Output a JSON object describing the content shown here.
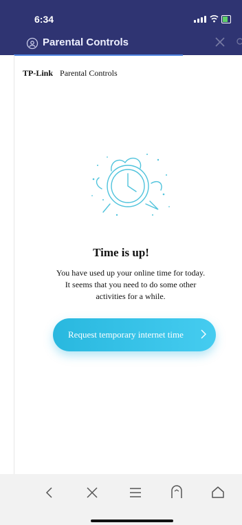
{
  "status": {
    "time": "6:34"
  },
  "header": {
    "title": "Parental Controls"
  },
  "site": {
    "brand": "TP-Link",
    "section": "Parental Controls"
  },
  "notice": {
    "heading": "Time is up!",
    "lines": [
      "You have used up your online time for today.",
      "It seems that you need to do some other",
      "activities for a while."
    ]
  },
  "actions": {
    "request_label": "Request temporary internet time"
  },
  "colors": {
    "header_bg": "#2f3472",
    "button_start": "#29b8df",
    "button_end": "#45ccf0",
    "illustration": "#4fc3dc",
    "toolbar_bg": "#f2f2f2"
  },
  "icons": {
    "app": "parental-controls-icon",
    "close": "close-icon",
    "toolbar": [
      "back-icon",
      "close-icon",
      "menu-icon",
      "tabs-icon",
      "home-icon"
    ]
  }
}
